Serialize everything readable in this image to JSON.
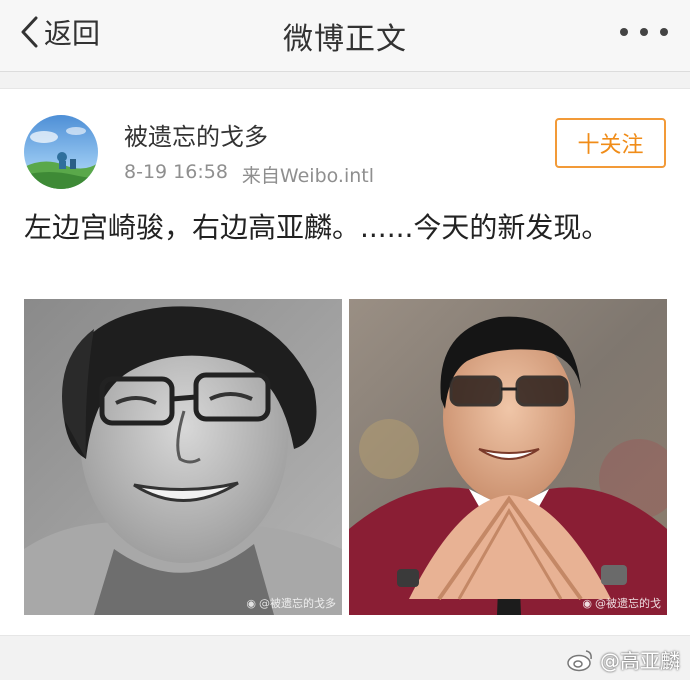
{
  "nav": {
    "back_label": "返回",
    "title": "微博正文"
  },
  "post": {
    "username": "被遗忘的戈多",
    "time": "8-19 16:58",
    "source": "来自Weibo.intl",
    "follow_label": "十关注",
    "text": "左边宫崎骏，右边高亚麟。......今天的新发现。"
  },
  "photos": {
    "left_watermark": "@被遗忘的戈多",
    "right_watermark": "@被遗忘的戈"
  },
  "corner_watermark": "@高亚麟",
  "colors": {
    "accent": "#f08c18",
    "navbar_bg": "#f7f7f7",
    "page_bg": "#f2f2f2"
  }
}
